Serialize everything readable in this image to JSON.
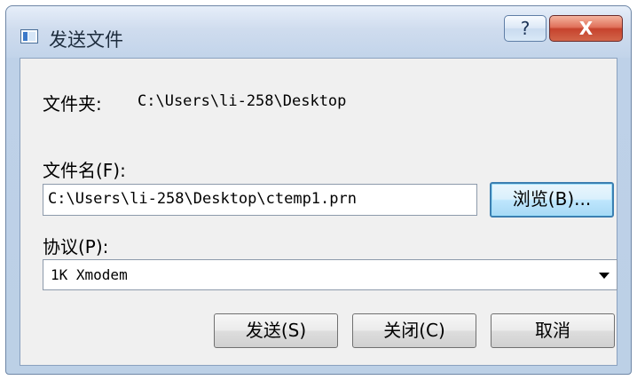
{
  "window": {
    "title": "发送文件",
    "help_label": "?",
    "close_label": "X"
  },
  "folder": {
    "label": "文件夹:",
    "value": "C:\\Users\\li-258\\Desktop"
  },
  "filename": {
    "label": "文件名(F):",
    "value": "C:\\Users\\li-258\\Desktop\\ctemp1.prn",
    "browse_label": "浏览(B)..."
  },
  "protocol": {
    "label": "协议(P):",
    "selected": "1K Xmodem"
  },
  "buttons": {
    "send": "发送(S)",
    "close": "关闭(C)",
    "cancel": "取消"
  }
}
